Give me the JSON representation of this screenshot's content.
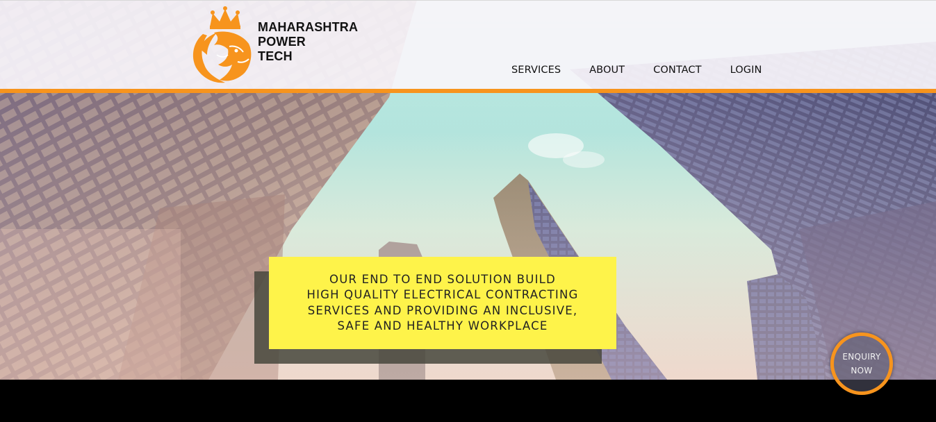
{
  "brand": {
    "line1": "MAHARASHTRA",
    "line2": "POWER",
    "line3": "TECH",
    "logo_icon": "lion-crown-icon",
    "accent_color": "#f7941d"
  },
  "nav": {
    "items": [
      {
        "label": "SERVICES"
      },
      {
        "label": "ABOUT"
      },
      {
        "label": "CONTACT"
      },
      {
        "label": "LOGIN"
      }
    ]
  },
  "hero": {
    "tagline": [
      "OUR END TO END SOLUTION BUILD",
      "HIGH QUALITY ELECTRICAL CONTRACTING",
      "SERVICES AND PROVIDING AN INCLUSIVE,",
      "SAFE AND HEALTHY WORKPLACE"
    ],
    "tagline_bg": "#fef34a"
  },
  "enquiry": {
    "line1": "ENQUIRY",
    "line2": "NOW"
  }
}
